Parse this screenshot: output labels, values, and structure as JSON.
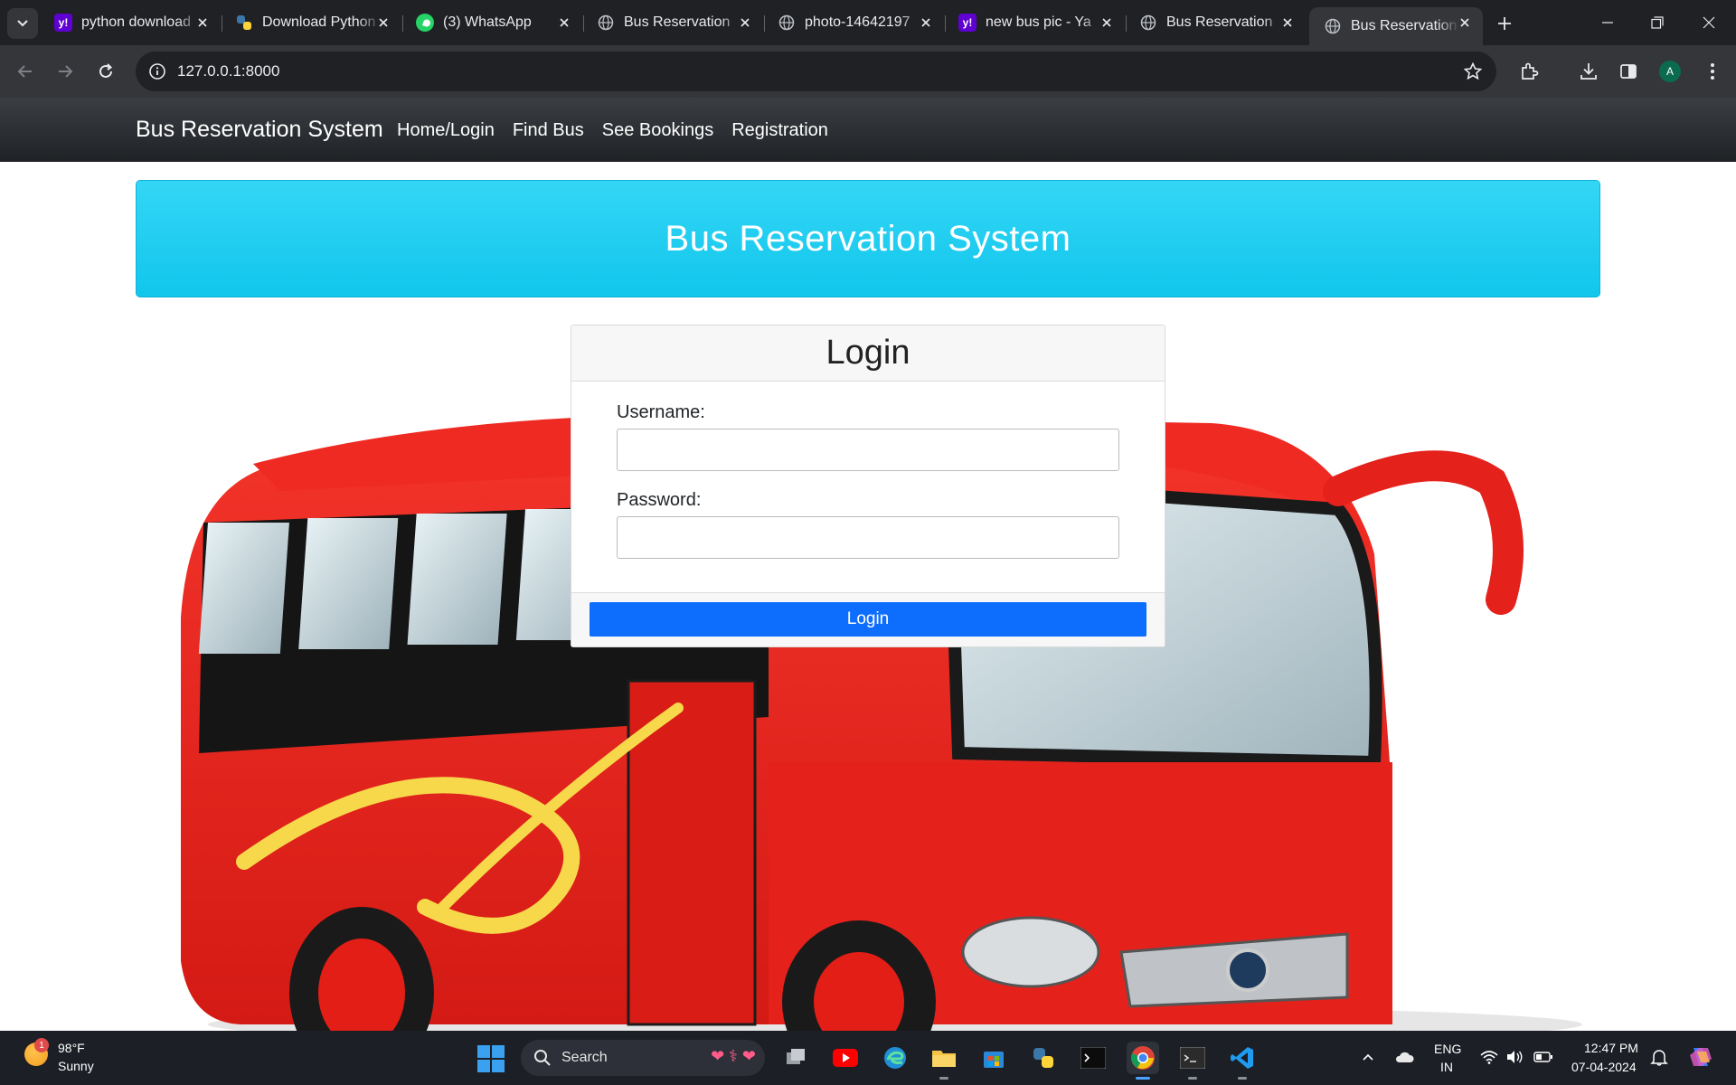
{
  "browser": {
    "tabs": [
      {
        "title": "python download",
        "favicon": "yahoo-icon",
        "active": false
      },
      {
        "title": "Download Python",
        "favicon": "python-icon",
        "active": false
      },
      {
        "title": "(3) WhatsApp",
        "favicon": "whatsapp-icon",
        "active": false
      },
      {
        "title": "Bus Reservation",
        "favicon": "globe-icon",
        "active": false
      },
      {
        "title": "photo-14642197",
        "favicon": "globe-icon",
        "active": false
      },
      {
        "title": "new bus pic - Ya",
        "favicon": "yahoo-icon",
        "active": false
      },
      {
        "title": "Bus Reservation",
        "favicon": "globe-icon",
        "active": false
      },
      {
        "title": "Bus Reservation",
        "favicon": "globe-icon",
        "active": true
      }
    ],
    "url": "127.0.0.1:8000",
    "profile_initial": "A"
  },
  "navbar": {
    "brand": "Bus Reservation System",
    "links": [
      "Home/Login",
      "Find Bus",
      "See Bookings",
      "Registration"
    ]
  },
  "jumbotron": {
    "title": "Bus Reservation System"
  },
  "login": {
    "title": "Login",
    "username_label": "Username:",
    "username_value": "",
    "password_label": "Password:",
    "password_value": "",
    "button": "Login"
  },
  "taskbar": {
    "weather_temp": "98°F",
    "weather_condition": "Sunny",
    "weather_badge": "1",
    "search_placeholder": "Search",
    "language_line1": "ENG",
    "language_line2": "IN",
    "time": "12:47 PM",
    "date": "07-04-2024"
  },
  "colors": {
    "navbar": "#2b2e33",
    "jumbotron": "#20cdf0",
    "login_button": "#0d6efd",
    "bus_red": "#e8231c"
  }
}
